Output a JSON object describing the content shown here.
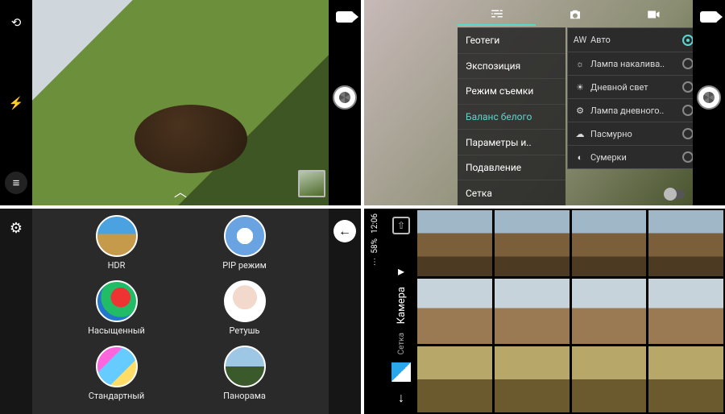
{
  "q1": {
    "chevron": "︿"
  },
  "q2": {
    "menu": [
      "Геотеги",
      "Экспозиция",
      "Режим съемки",
      "Баланс белого",
      "Параметры и..",
      "Подавление",
      "Сетка"
    ],
    "selected_index": 3,
    "wb": [
      {
        "icon": "AW",
        "label": "Авто",
        "on": true
      },
      {
        "icon": "☼",
        "label": "Лампа накалива..",
        "on": false
      },
      {
        "icon": "☀",
        "label": "Дневной свет",
        "on": false
      },
      {
        "icon": "⚙",
        "label": "Лампа дневного..",
        "on": false
      },
      {
        "icon": "☁",
        "label": "Пасмурно",
        "on": false
      },
      {
        "icon": "◐",
        "label": "Сумерки",
        "on": false
      }
    ]
  },
  "q3": {
    "modes": [
      {
        "label": "HDR",
        "cls": "c-hdr"
      },
      {
        "label": "PIP режим",
        "cls": "c-pip"
      },
      {
        "label": "Насыщенный",
        "cls": "c-sat"
      },
      {
        "label": "Ретушь",
        "cls": "c-ret"
      },
      {
        "label": "Стандартный",
        "cls": "c-std"
      },
      {
        "label": "Панорама",
        "cls": "c-pan"
      }
    ]
  },
  "q4": {
    "time": "12:06",
    "battery": "58%",
    "title": "Камера",
    "subtitle": "Сетка"
  }
}
